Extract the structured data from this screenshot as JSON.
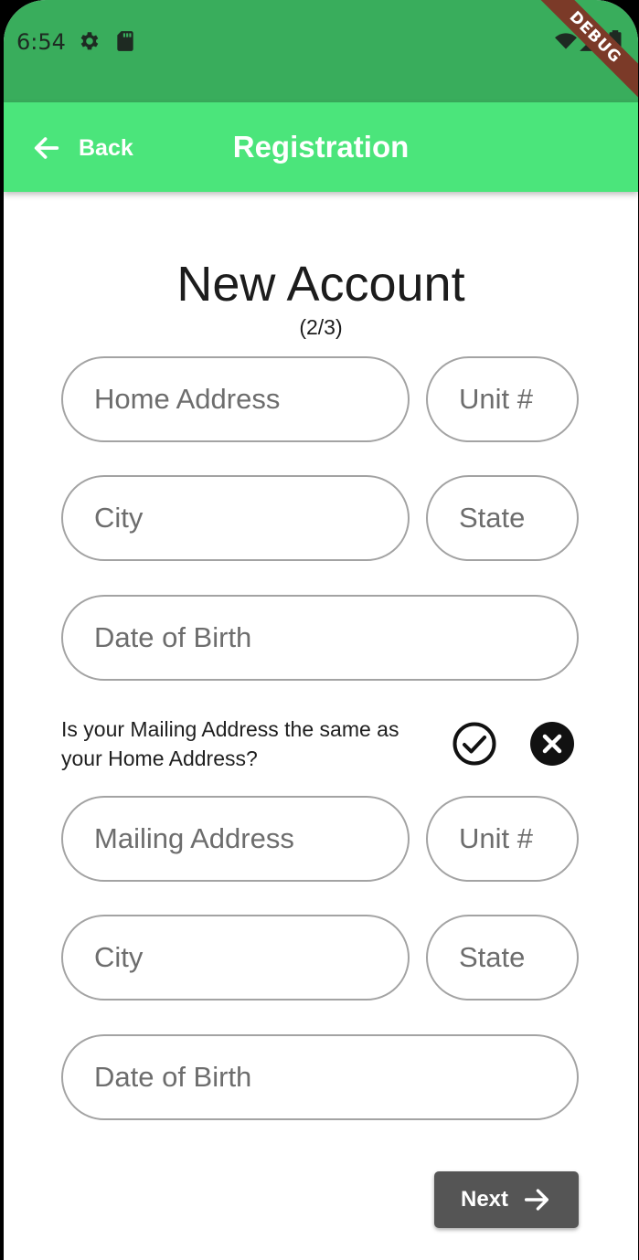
{
  "status_bar": {
    "time": "6:54",
    "icons": [
      "settings-icon",
      "sd-card-icon",
      "wifi-icon",
      "signal-icon",
      "battery-icon"
    ],
    "debug_label": "DEBUG"
  },
  "app_bar": {
    "back_label": "Back",
    "title": "Registration",
    "background": "#4be57b"
  },
  "form": {
    "heading": "New Account",
    "step": "(2/3)",
    "home_address_placeholder": "Home Address",
    "home_unit_placeholder": "Unit #",
    "home_city_placeholder": "City",
    "home_state_placeholder": "State",
    "home_dob_placeholder": "Date of Birth",
    "mailing_question": "Is your Mailing Address the same as your Home Address?",
    "mailing_address_placeholder": "Mailing Address",
    "mailing_unit_placeholder": "Unit #",
    "mailing_city_placeholder": "City",
    "mailing_state_placeholder": "State",
    "mailing_dob_placeholder": "Date of Birth",
    "next_label": "Next"
  },
  "colors": {
    "status_bar": "#39ad5c",
    "accent": "#4be57b",
    "button": "#555555"
  }
}
